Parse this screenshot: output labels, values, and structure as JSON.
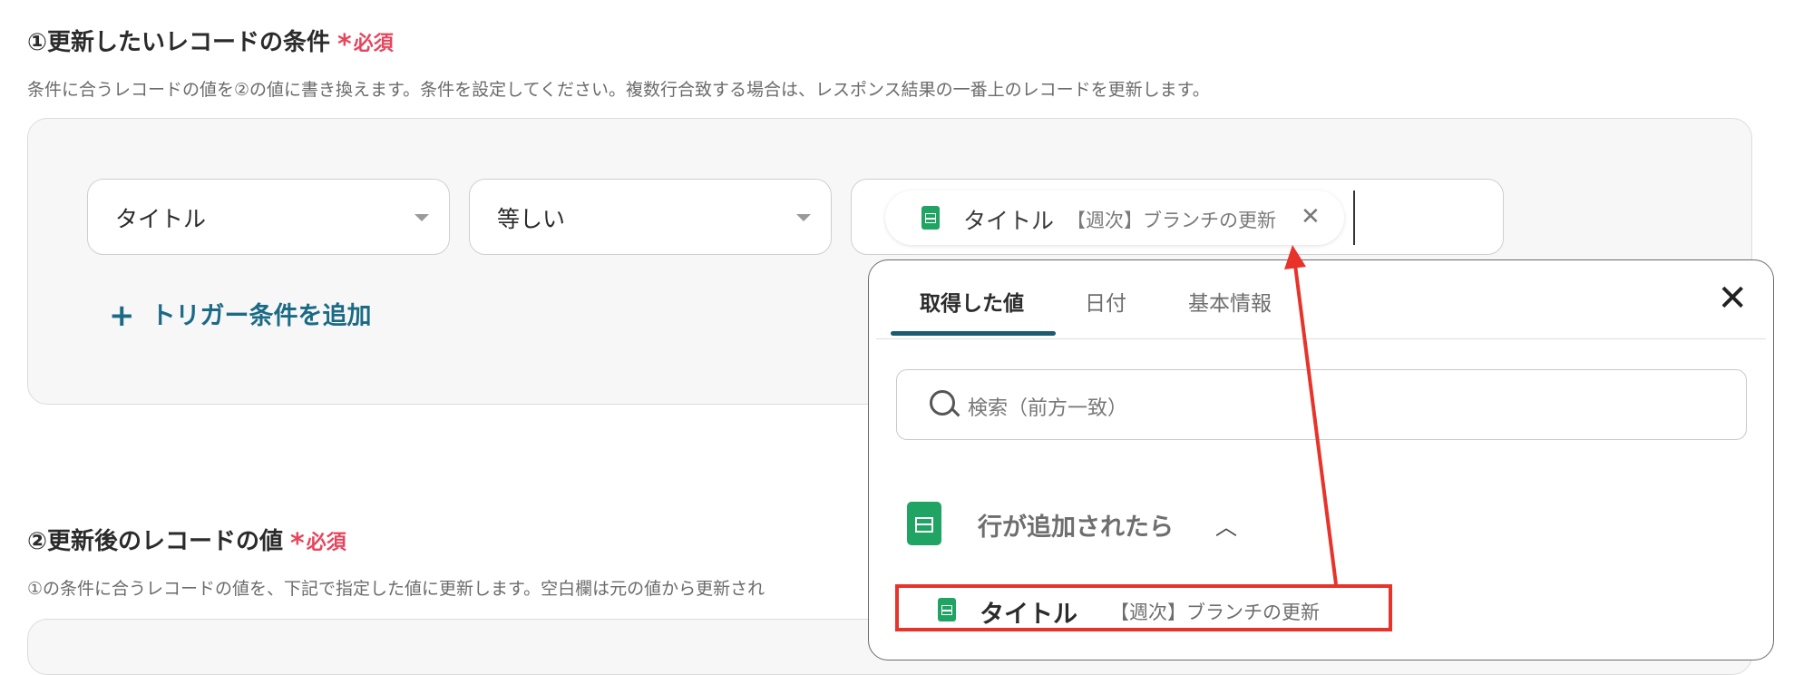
{
  "section1": {
    "title": "①更新したいレコードの条件",
    "required_star": "*",
    "required_label": "必須",
    "description": "条件に合うレコードの値を②の値に書き換えます。条件を設定してください。複数行合致する場合は、レスポンス結果の一番上のレコードを更新します。"
  },
  "condition": {
    "field": "タイトル",
    "operator": "等しい",
    "chip_label": "タイトル",
    "chip_value": "【週次】ブランチの更新",
    "chip_close": "✕"
  },
  "add_trigger": {
    "plus": "+",
    "label": "トリガー条件を追加"
  },
  "section2": {
    "title": "②更新後のレコードの値",
    "required_star": "*",
    "required_label": "必須",
    "description": "①の条件に合うレコードの値を、下記で指定した値に更新します。空白欄は元の値から更新され"
  },
  "dropdown": {
    "tabs": [
      {
        "label": "取得した値"
      },
      {
        "label": "日付"
      },
      {
        "label": "基本情報"
      }
    ],
    "close": "✕",
    "search_placeholder": "検索（前方一致）",
    "group_label": "行が追加されたら",
    "group_chevron": "︿",
    "item_label": "タイトル",
    "item_value": "【週次】ブランチの更新"
  },
  "colors": {
    "required": "#e8455c",
    "accent": "#1b6a86",
    "tab_underline": "#1b5b72",
    "sheets_green": "#1fa463",
    "annotation_red": "#e8332a"
  },
  "icons": [
    "sheets-icon",
    "search-icon",
    "close-icon",
    "plus-icon",
    "chevron-up-icon",
    "caret-down-icon"
  ]
}
